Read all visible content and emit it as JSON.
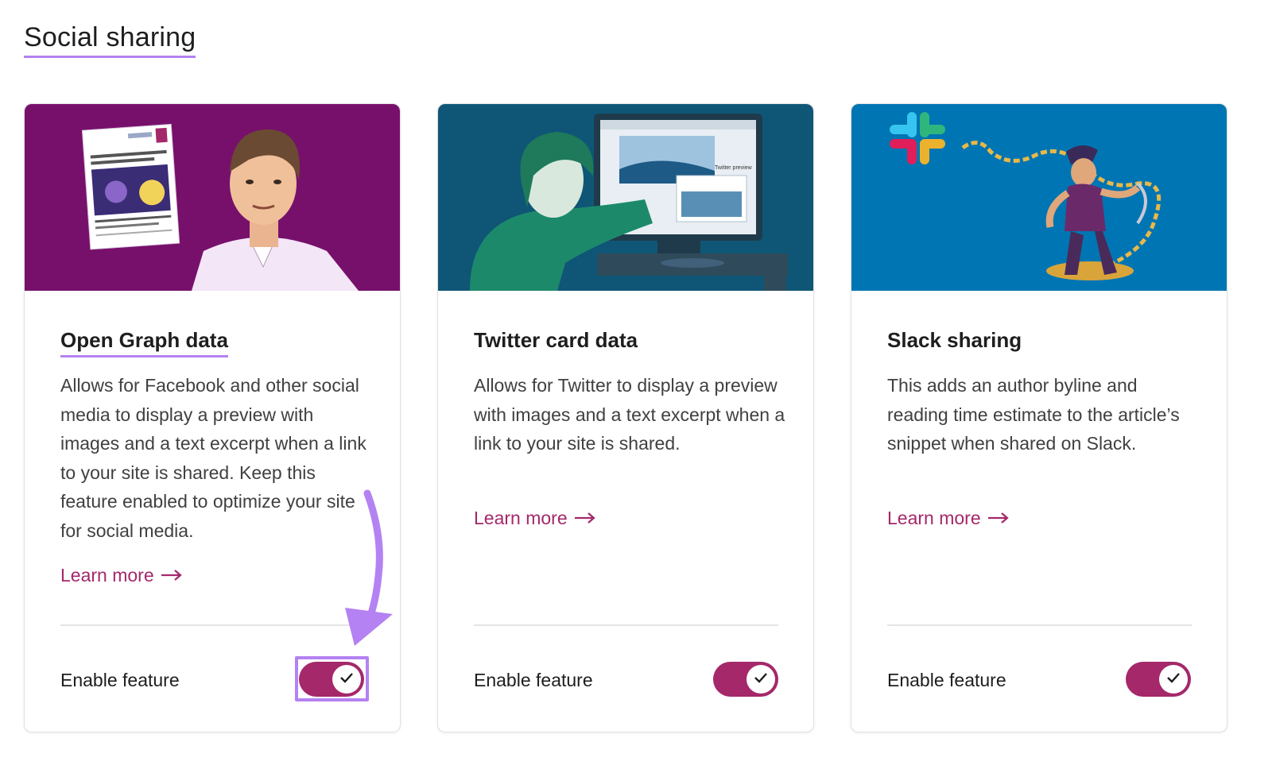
{
  "page": {
    "section_title": "Social sharing"
  },
  "colors": {
    "accent": "#a4286a",
    "highlight": "#b482f2",
    "card_border": "#e2e2e2",
    "card1_banner": "#77106b",
    "card2_banner": "#0f5676",
    "card3_banner": "#0075b3"
  },
  "cards": [
    {
      "title": "Open Graph data",
      "description": "Allows for Facebook and other social media to display a preview with images and a text excerpt when a link to your site is shared. Keep this feature enabled to optimize your site for social media.",
      "learn_more": "Learn more",
      "enable_label": "Enable feature",
      "enabled": true,
      "illustration": "man-looking-at-preview-card"
    },
    {
      "title": "Twitter card data",
      "description": "Allows for Twitter to display a preview with images and a text excerpt when a link to your site is shared.",
      "learn_more": "Learn more",
      "enable_label": "Enable feature",
      "enabled": true,
      "illustration": "person-at-computer-twitter-preview",
      "illustration_text": "Twitter preview"
    },
    {
      "title": "Slack sharing",
      "description": "This adds an author byline and reading time estimate to the article’s snippet when shared on Slack.",
      "learn_more": "Learn more",
      "enable_label": "Enable feature",
      "enabled": true,
      "illustration": "pirate-with-chain-and-slack-logo"
    }
  ],
  "icons": {
    "arrow": "arrow-right-icon",
    "check": "check-icon",
    "annotation": "purple-curved-arrow-icon"
  }
}
